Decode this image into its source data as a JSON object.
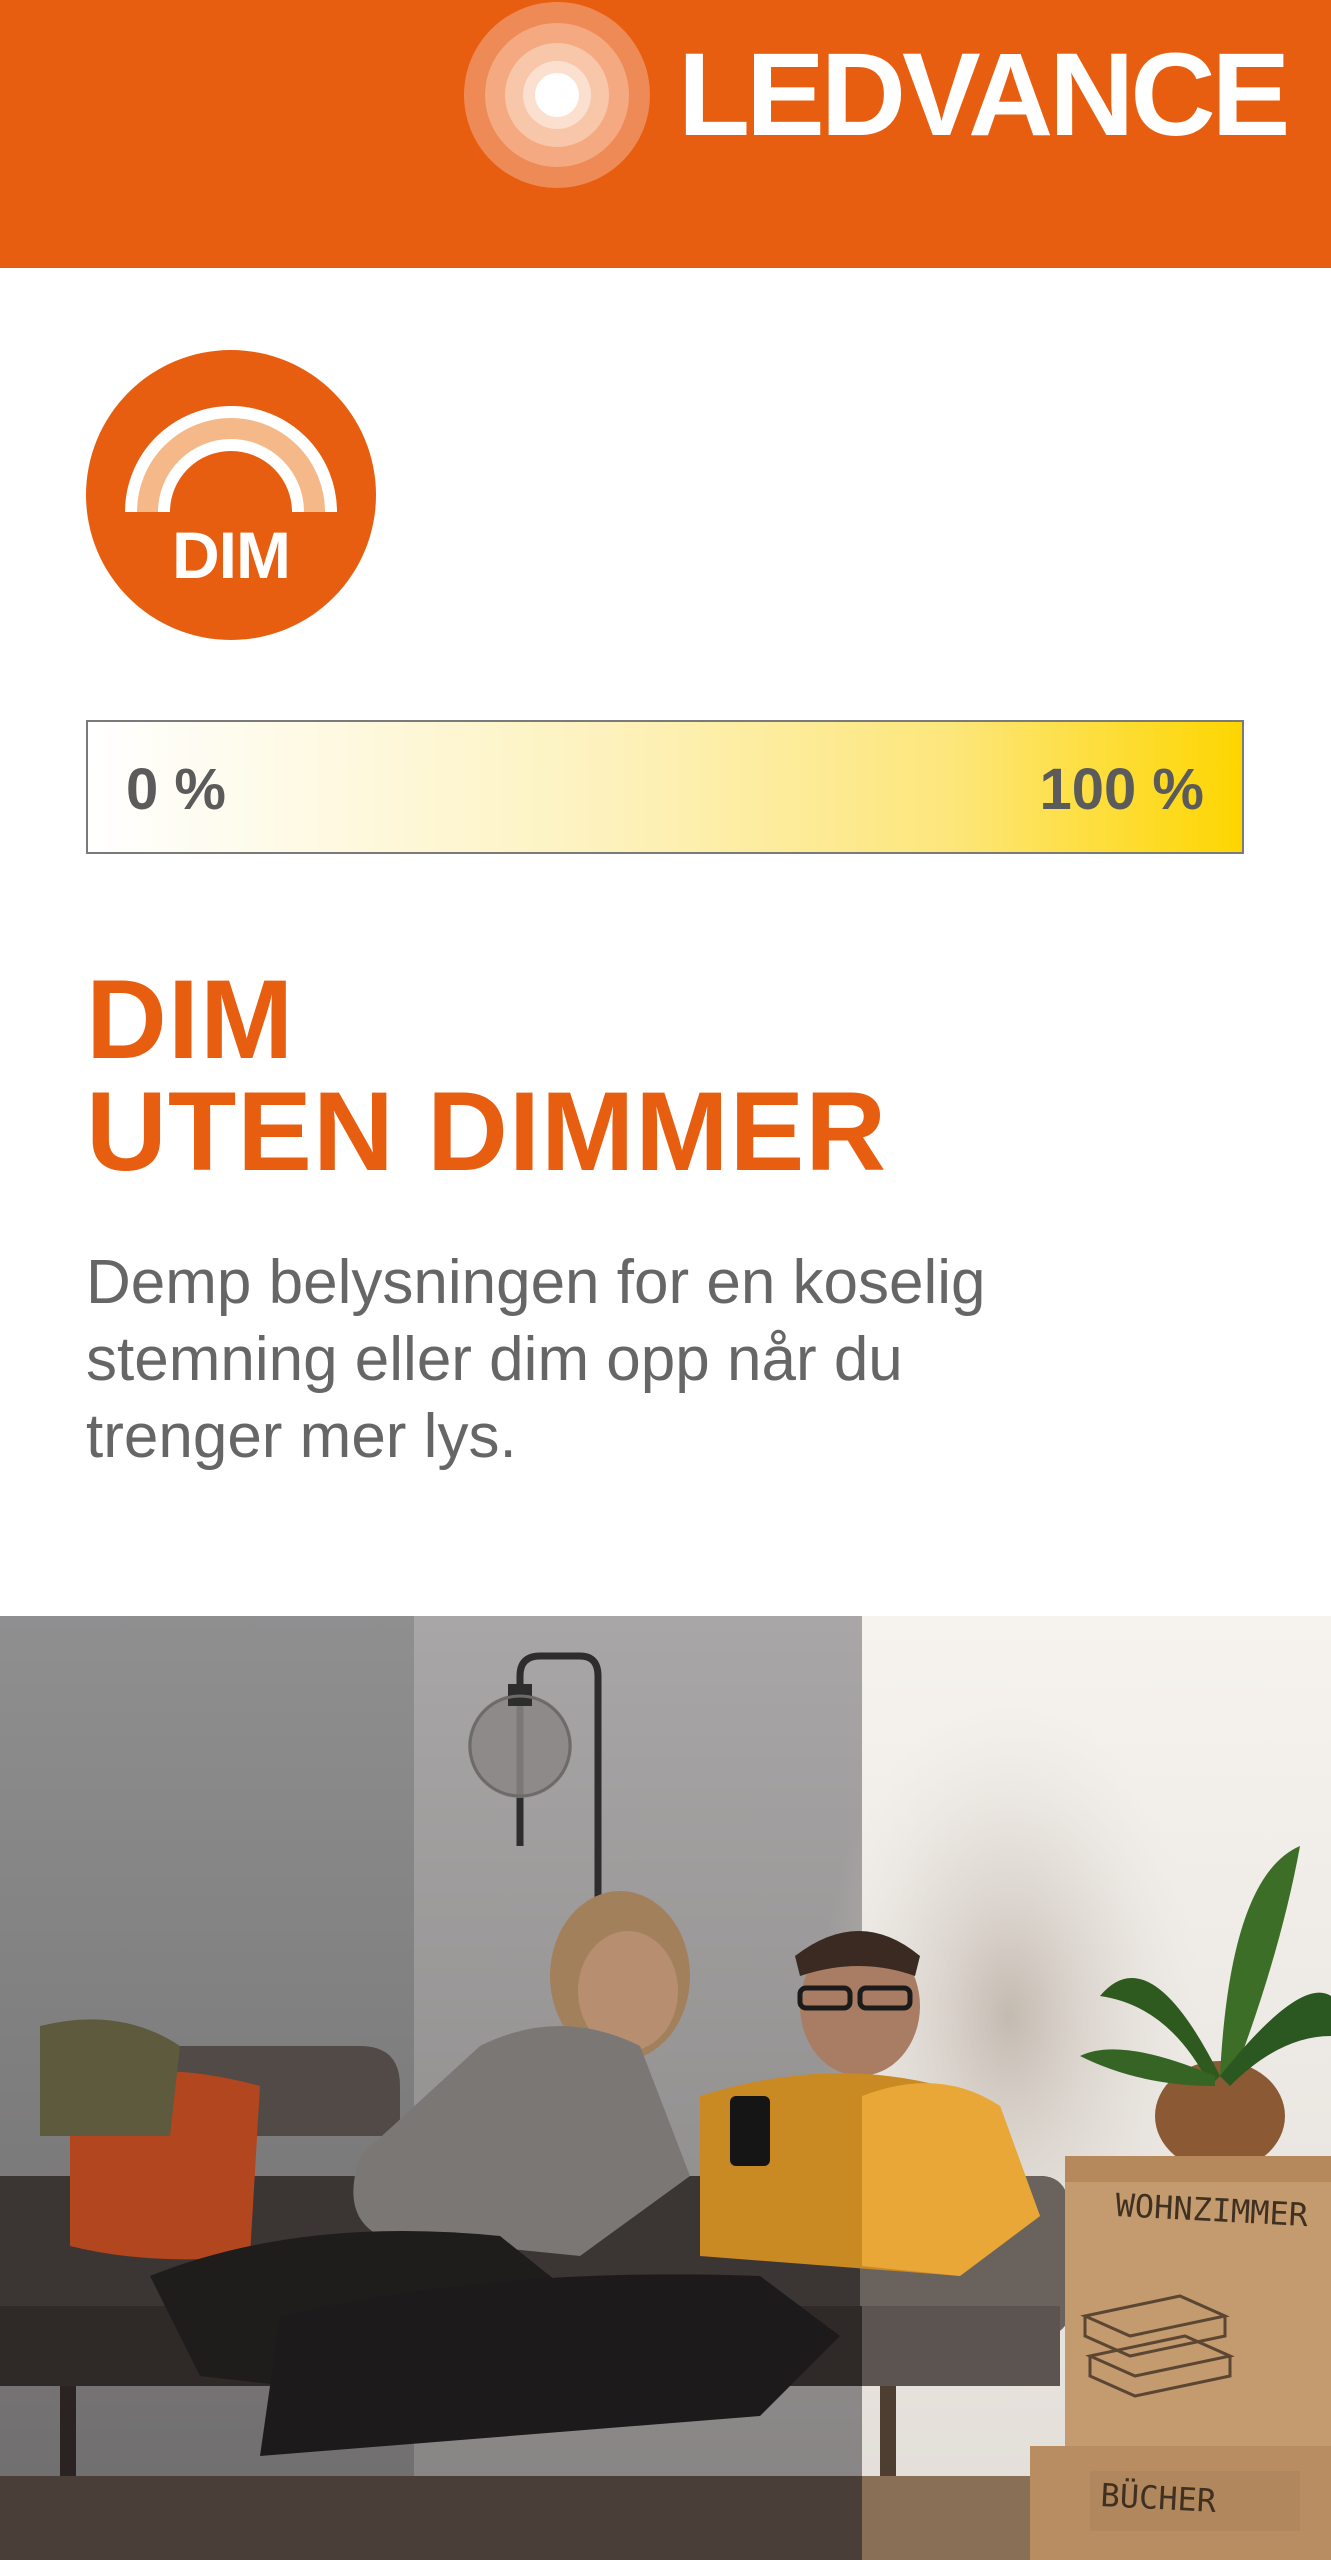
{
  "brand": {
    "name": "LEDVANCE",
    "color": "#e85e10",
    "logo_icon": "concentric-circles-logo"
  },
  "badge": {
    "label": "DIM",
    "icon": "dim-arc-icon"
  },
  "dim_bar": {
    "min_label": "0 %",
    "max_label": "100 %",
    "gradient_colors": [
      "#ffffff",
      "#fdd600"
    ],
    "border_color": "#7a7a7a"
  },
  "headline": {
    "line1": "DIM",
    "line2": "UTEN DIMMER"
  },
  "body": {
    "line1": "Demp belysningen for en koselig",
    "line2": "stemning eller dim opp når du",
    "line3": "trenger mer lys."
  },
  "photo": {
    "box_label_1": "WOHNZIMMER",
    "box_label_2": "BÜCHER"
  }
}
